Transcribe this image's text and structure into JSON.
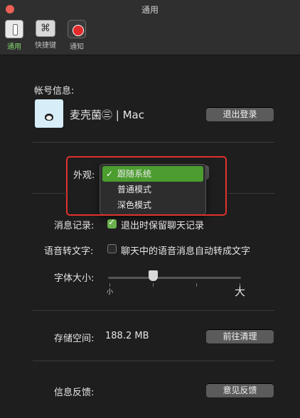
{
  "window": {
    "title": "通用"
  },
  "toolbar": {
    "items": [
      {
        "label": "通用",
        "icon": "general-icon",
        "active": true
      },
      {
        "label": "快捷键",
        "icon": "shortcut-icon",
        "glyph": "⌘",
        "active": false
      },
      {
        "label": "通知",
        "icon": "notification-icon",
        "active": false
      }
    ]
  },
  "account": {
    "section_label": "帐号信息:",
    "username": "麦壳菌㊂ | Mac",
    "logout_label": "退出登录"
  },
  "appearance": {
    "label": "外观:",
    "options": [
      "跟随系统",
      "普通模式",
      "深色模式"
    ],
    "selected": "跟随系统",
    "check_glyph": "✓"
  },
  "chat_history": {
    "label": "消息记录:",
    "checkbox_label": "退出时保留聊天记录",
    "checked": true
  },
  "voice_to_text": {
    "label": "语音转文字:",
    "checkbox_label": "聊天中的语音消息自动转成文字",
    "checked": false
  },
  "font_size": {
    "label": "字体大小:",
    "min_label": "小",
    "max_label": "大"
  },
  "storage": {
    "label": "存储空间:",
    "value": "188.2 MB",
    "button_label": "前往清理"
  },
  "feedback": {
    "label": "信息反馈:",
    "button_label": "意见反馈"
  },
  "colors": {
    "accent_green": "#4c9d2f",
    "highlight_red": "#e0322b",
    "background": "#1e1e1e"
  }
}
